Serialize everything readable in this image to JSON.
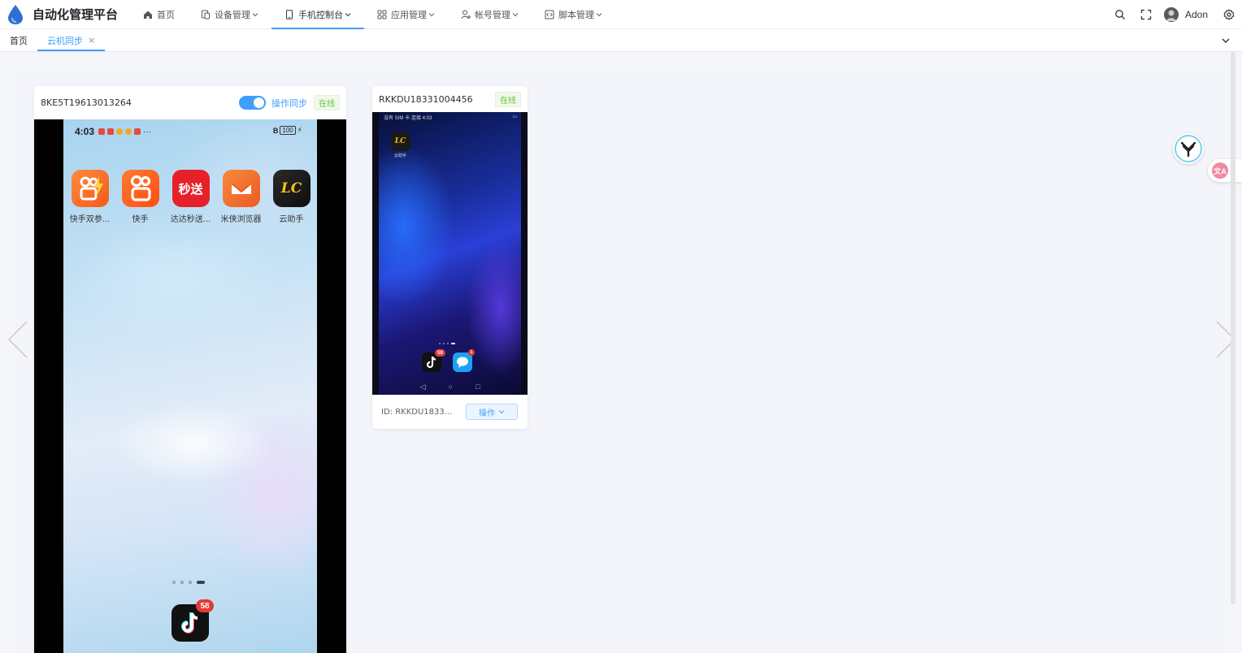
{
  "app": {
    "title": "自动化管理平台"
  },
  "nav": {
    "items": [
      {
        "label": "首页",
        "icon": "home-icon",
        "has_dropdown": false,
        "active": false
      },
      {
        "label": "设备管理",
        "icon": "device-icon",
        "has_dropdown": true,
        "active": false
      },
      {
        "label": "手机控制台",
        "icon": "phone-icon",
        "has_dropdown": true,
        "active": true
      },
      {
        "label": "应用管理",
        "icon": "grid-icon",
        "has_dropdown": true,
        "active": false
      },
      {
        "label": "帐号管理",
        "icon": "user-icon",
        "has_dropdown": true,
        "active": false
      },
      {
        "label": "脚本管理",
        "icon": "script-icon",
        "has_dropdown": true,
        "active": false
      }
    ],
    "user": {
      "name": "Adon"
    }
  },
  "tabs": [
    {
      "label": "首页",
      "active": false,
      "closable": false
    },
    {
      "label": "云机同步",
      "active": true,
      "closable": true,
      "close_glyph": "×"
    }
  ],
  "devices": [
    {
      "id": "8KE5T19613013264",
      "sync_enabled": true,
      "sync_label": "操作同步",
      "status": "在线",
      "screen": {
        "time": "4:03",
        "status_extra": "···",
        "battery": "100",
        "apps": [
          {
            "label": "快手双参...",
            "icon": "kuaishou-dual-icon",
            "color": "#f5641e"
          },
          {
            "label": "快手",
            "icon": "kuaishou-icon",
            "color": "#ff5a1f"
          },
          {
            "label": "达达秒送...",
            "icon": "dada-icon",
            "color": "#e62129",
            "text": "秒送"
          },
          {
            "label": "米侠浏览器",
            "icon": "mixia-browser-icon",
            "color": "#f26522"
          },
          {
            "label": "云助手",
            "icon": "yunzhushou-icon",
            "color": "#1c1c1c",
            "text": "LC"
          }
        ],
        "dock": {
          "icon": "tiktok-icon",
          "badge": "58"
        }
      }
    },
    {
      "id": "RKKDU18331004456",
      "status": "在线",
      "screen": {
        "status_left": "没有 SIM 卡·连接 4:03",
        "app": {
          "label": "云助手",
          "icon": "yunzhushou-icon",
          "text": "LC"
        },
        "dock": [
          {
            "icon": "tiktok-icon",
            "badge": "58",
            "color": "#111111"
          },
          {
            "icon": "message-icon",
            "badge": "1",
            "color": "#1ea1f2"
          }
        ]
      },
      "footer_id": "ID: RKKDU1833...",
      "op_label": "操作"
    }
  ],
  "colors": {
    "accent": "#409eff",
    "online": "#67c23a"
  }
}
